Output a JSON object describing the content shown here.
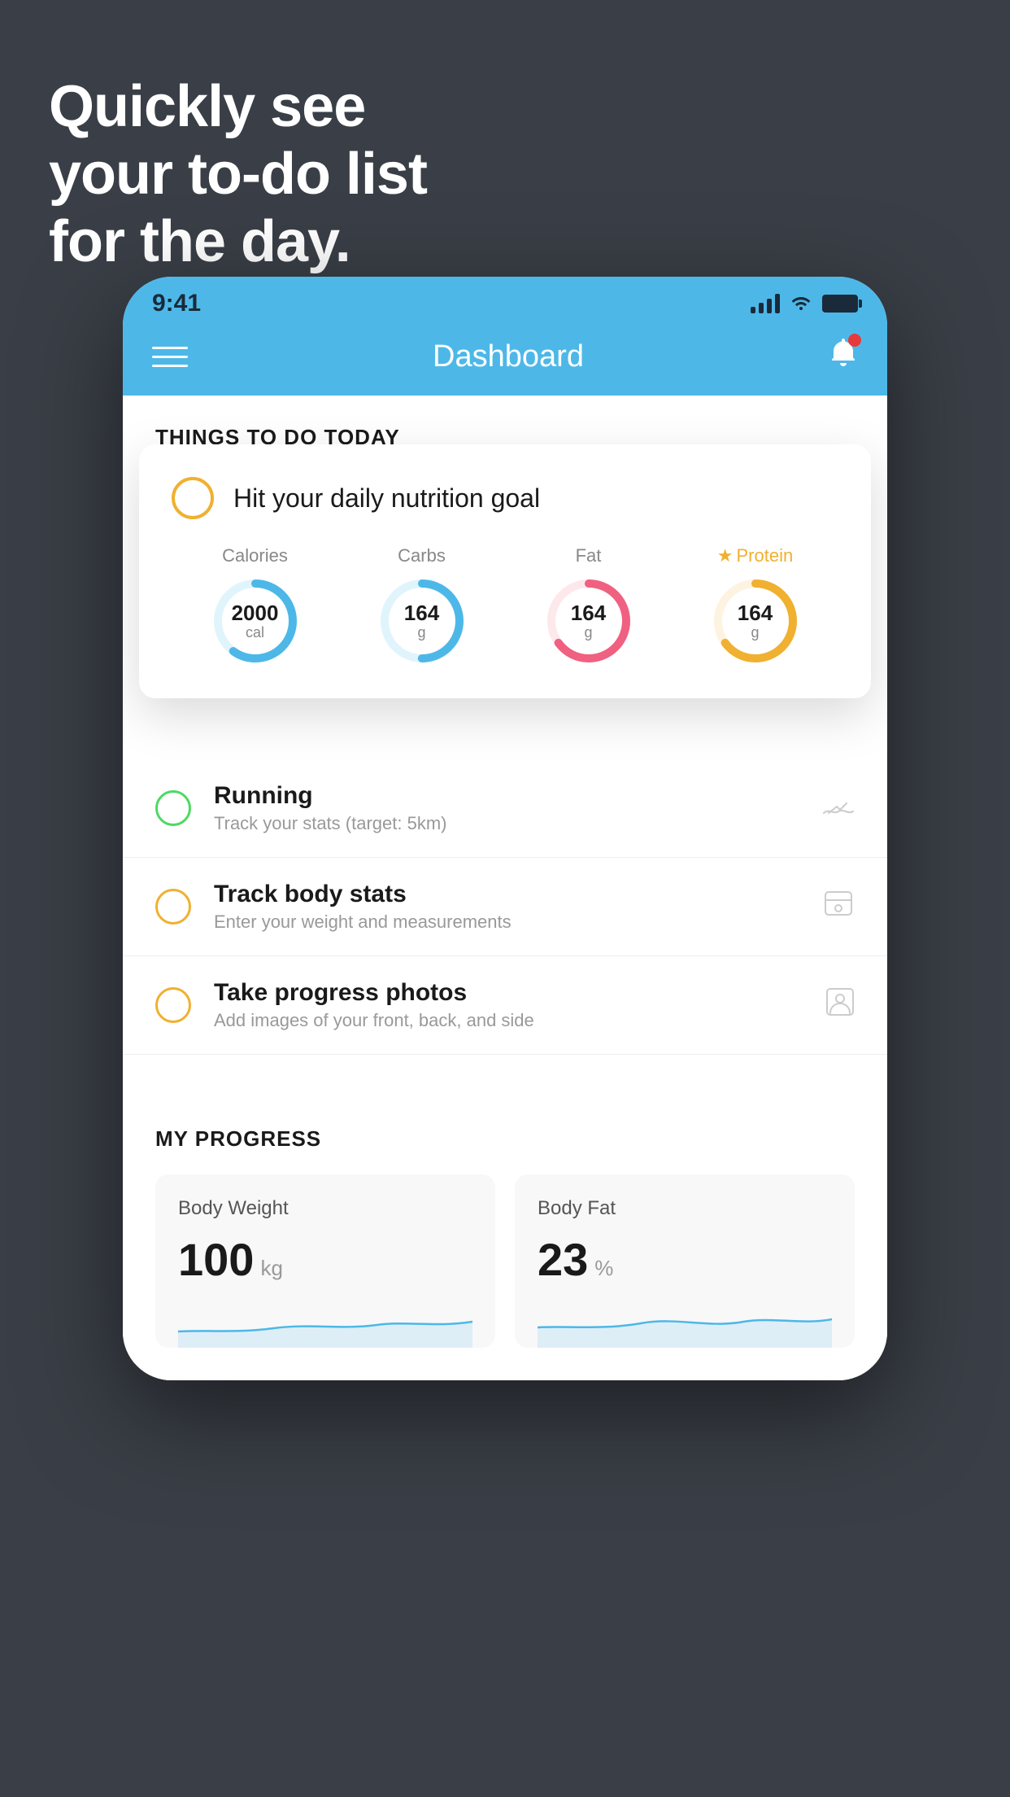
{
  "hero": {
    "line1": "Quickly see",
    "line2": "your to-do list",
    "line3": "for the day."
  },
  "statusBar": {
    "time": "9:41"
  },
  "navBar": {
    "title": "Dashboard"
  },
  "sectionHeader": "THINGS TO DO TODAY",
  "floatingCard": {
    "title": "Hit your daily nutrition goal",
    "items": [
      {
        "label": "Calories",
        "value": "2000",
        "unit": "cal",
        "color": "#4db8e8",
        "trackColor": "#e0f4fc",
        "progress": 0.6,
        "starred": false
      },
      {
        "label": "Carbs",
        "value": "164",
        "unit": "g",
        "color": "#4db8e8",
        "trackColor": "#e0f4fc",
        "progress": 0.5,
        "starred": false
      },
      {
        "label": "Fat",
        "value": "164",
        "unit": "g",
        "color": "#f06080",
        "trackColor": "#fde8ec",
        "progress": 0.7,
        "starred": false
      },
      {
        "label": "Protein",
        "value": "164",
        "unit": "g",
        "color": "#f0b030",
        "trackColor": "#fef3e0",
        "progress": 0.65,
        "starred": true
      }
    ]
  },
  "todoItems": [
    {
      "title": "Running",
      "subtitle": "Track your stats (target: 5km)",
      "circleColor": "green",
      "icon": "👟"
    },
    {
      "title": "Track body stats",
      "subtitle": "Enter your weight and measurements",
      "circleColor": "yellow",
      "icon": "⚖️"
    },
    {
      "title": "Take progress photos",
      "subtitle": "Add images of your front, back, and side",
      "circleColor": "yellow",
      "icon": "👤"
    }
  ],
  "progressSection": {
    "header": "MY PROGRESS",
    "cards": [
      {
        "title": "Body Weight",
        "value": "100",
        "unit": "kg"
      },
      {
        "title": "Body Fat",
        "value": "23",
        "unit": "%"
      }
    ]
  },
  "colors": {
    "background": "#3a3f47",
    "blue": "#4db8e8",
    "green": "#4cd964",
    "yellow": "#f0b030",
    "red": "#e83a3a"
  }
}
